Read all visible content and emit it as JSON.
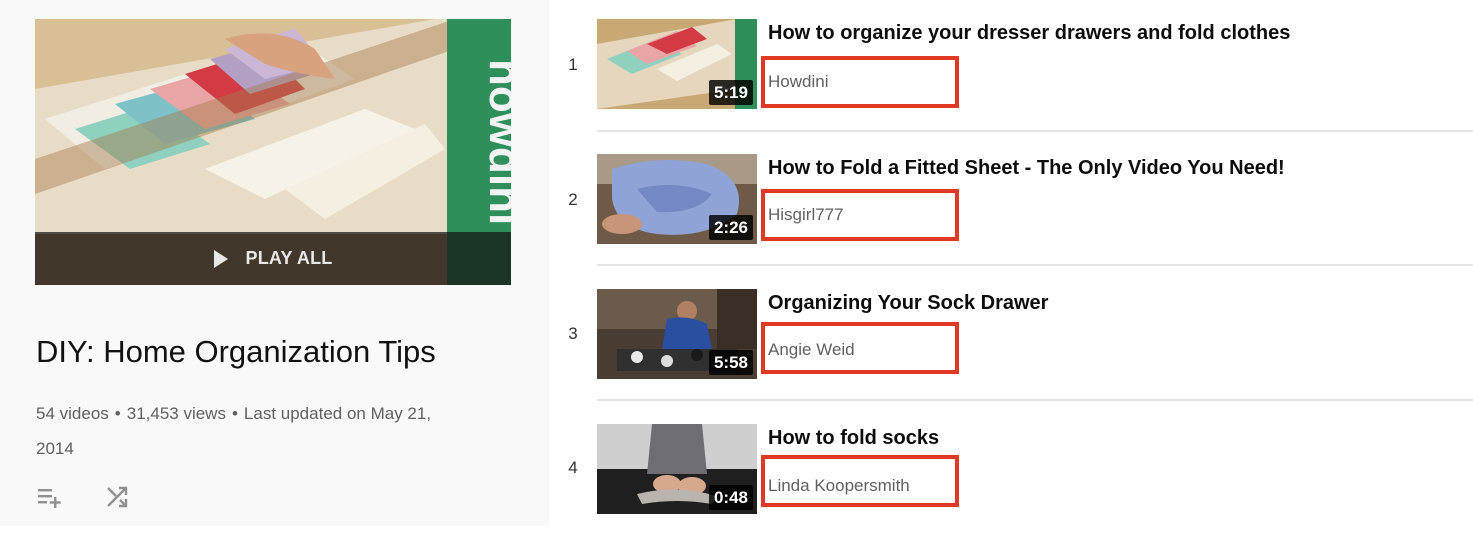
{
  "playlist": {
    "play_all_label": "PLAY ALL",
    "hero_brand": "howdini",
    "title": "DIY: Home Organization Tips",
    "video_count": "54 videos",
    "views": "31,453 views",
    "last_updated_line1": "Last updated on May 21,",
    "last_updated_line2": "2014",
    "separator": "•",
    "actions": [
      {
        "icon": "add-to-queue-icon"
      },
      {
        "icon": "shuffle-icon"
      }
    ]
  },
  "colors": {
    "highlight": "#e03a24",
    "brand_green": "#2f8f5b"
  },
  "videos": [
    {
      "index": "1",
      "title": "How to organize your dresser drawers and fold clothes",
      "channel": "Howdini",
      "duration": "5:19"
    },
    {
      "index": "2",
      "title": "How to Fold a Fitted Sheet - The Only Video You Need!",
      "channel": "Hisgirl777",
      "duration": "2:26"
    },
    {
      "index": "3",
      "title": "Organizing Your Sock Drawer",
      "channel": "Angie Weid",
      "duration": "5:58"
    },
    {
      "index": "4",
      "title": "How to fold socks",
      "channel": "Linda Koopersmith",
      "duration": "0:48"
    }
  ]
}
